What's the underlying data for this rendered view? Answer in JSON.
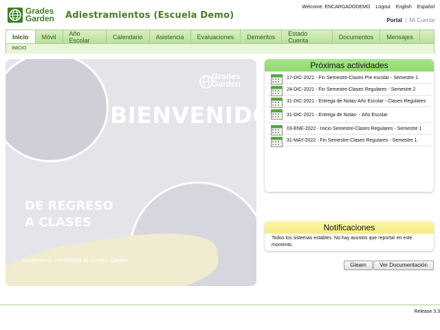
{
  "header": {
    "logo_line1": "Grades",
    "logo_line2": "Garden",
    "title": "Adiestramientos (Escuela Demo)",
    "welcome": "Welcome: ENCARGADODEMO",
    "logout": "Logout",
    "english": "English",
    "espanol": "Español",
    "portal": "Portal",
    "separator": "|",
    "mi_cuenta": "Mi Cuenta"
  },
  "nav": {
    "tabs": [
      {
        "label": "Inicio"
      },
      {
        "label": "Móvil"
      },
      {
        "label": "Año Escolar"
      },
      {
        "label": "Calendario"
      },
      {
        "label": "Asistencia"
      },
      {
        "label": "Evaluaciones"
      },
      {
        "label": "Deméritos"
      },
      {
        "label": "Estado Cuenta"
      },
      {
        "label": "Documentos"
      },
      {
        "label": "Mensajes"
      }
    ],
    "breadcrumb": "INICIO"
  },
  "banner": {
    "logo_line1": "Grades",
    "logo_line2": "Garden",
    "title": "BIENVENIDOS",
    "sub1": "DE REGRESO",
    "sub2": "A CLASES",
    "footer": "les desea su comunidad de Grades Garden"
  },
  "activities": {
    "title": "Próximas actividades",
    "items": [
      {
        "text": "17-DIC-2021 - Fin Semestre-Clases Pre escolar - Semestre 1"
      },
      {
        "text": "24-DIC-2021 - Fin Semestre-Clases Regulares - Semestre 2"
      },
      {
        "text": "31-DIC-2021 - Entrega de Notas-Año Escolar - Clases Regulares"
      },
      {
        "text": "31-DIC-2021 - Entrega de Notas- - Año Escolar"
      },
      {
        "text": "03-ENE-2022 - Inicio Semestre-Clases Regulares - Semestre 1"
      },
      {
        "text": "31-MAY-2022 - Fin Semestre-Clases Regulares - Semestre 1"
      }
    ]
  },
  "notifications": {
    "title": "Notificaciones",
    "body": "Todos los sistemas estables. No hay asuntos que reportar en este momento."
  },
  "buttons": {
    "gleam": "Gleam",
    "ver_doc": "Ver Documentación"
  },
  "footer": {
    "release": "Release 3.3"
  },
  "colors": {
    "brand_green": "#4a7a2a",
    "nav_green": "#b9e09a",
    "activities_header": "#8fd86d",
    "notifications_header": "#f4ec86"
  }
}
